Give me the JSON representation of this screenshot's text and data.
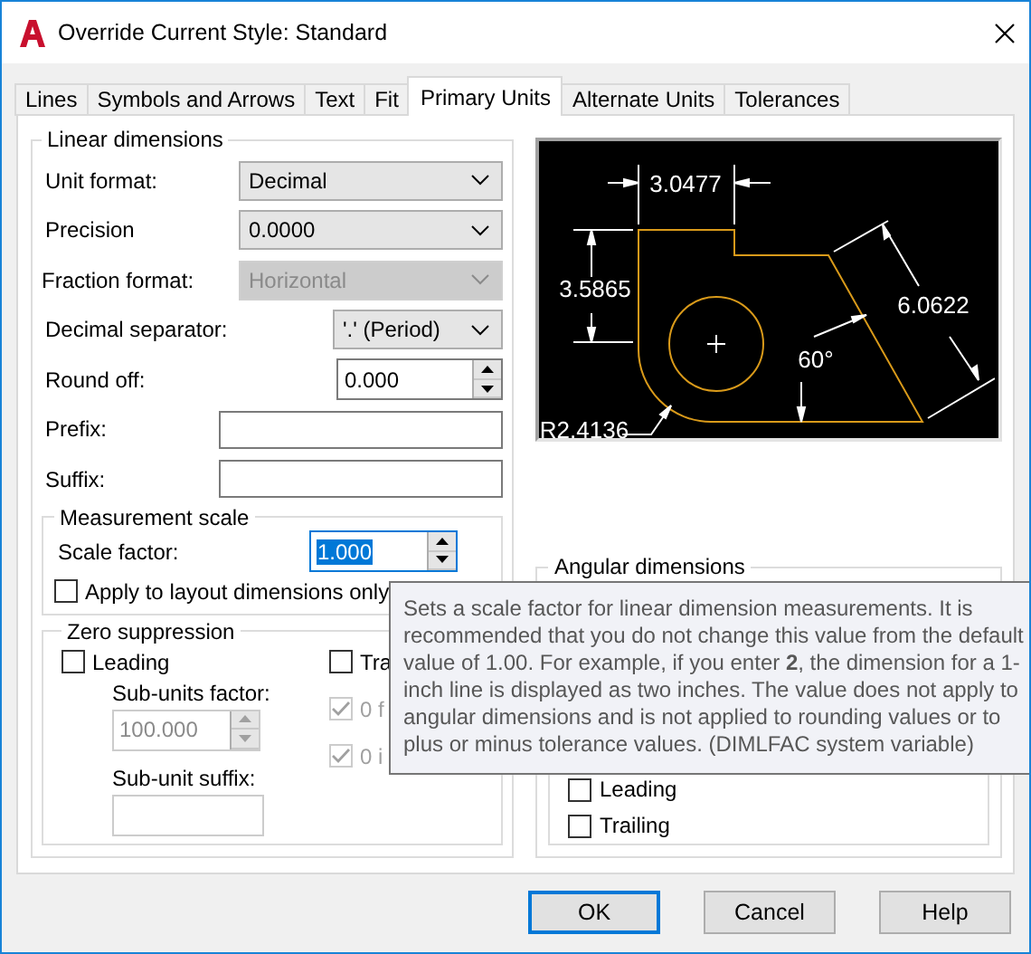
{
  "window": {
    "title": "Override Current Style: Standard"
  },
  "tabs": [
    {
      "label": "Lines",
      "selected": false
    },
    {
      "label": "Symbols and Arrows",
      "selected": false
    },
    {
      "label": "Text",
      "selected": false
    },
    {
      "label": "Fit",
      "selected": false
    },
    {
      "label": "Primary Units",
      "selected": true
    },
    {
      "label": "Alternate Units",
      "selected": false
    },
    {
      "label": "Tolerances",
      "selected": false
    }
  ],
  "linear": {
    "title": "Linear dimensions",
    "fields": [
      {
        "kind": "select",
        "label": "Unit format:",
        "value": "Decimal",
        "disabled": false
      },
      {
        "kind": "select",
        "label": "Precision",
        "value": "0.0000",
        "disabled": false
      },
      {
        "kind": "select",
        "label": "Fraction format:",
        "value": "Horizontal",
        "disabled": true
      },
      {
        "kind": "select",
        "label": "Decimal separator:",
        "value": "'.' (Period)",
        "disabled": false
      },
      {
        "kind": "spinner",
        "label": "Round off:",
        "value": "0.000",
        "disabled": false
      },
      {
        "kind": "text",
        "label": "Prefix:",
        "disabled": false
      },
      {
        "kind": "text",
        "label": "Suffix:",
        "disabled": false
      }
    ]
  },
  "measurement": {
    "title": "Measurement scale",
    "scale_label": "Scale factor:",
    "scale_value": "1.000",
    "selected": true,
    "apply": {
      "label": "Apply to layout dimensions only",
      "checked": false
    }
  },
  "zero": {
    "title": "Zero suppression",
    "leading": {
      "label": "Leading",
      "checked": false
    },
    "sub_units_factor": {
      "label": "Sub-units factor:",
      "value": "100.000",
      "disabled": true
    },
    "sub_unit_suffix": {
      "label": "Sub-unit suffix:"
    },
    "right": [
      {
        "label": "Tra",
        "checked": false,
        "disabled": false
      },
      {
        "label": "0 f",
        "checked": true,
        "disabled": true
      },
      {
        "label": "0 i",
        "checked": true,
        "disabled": true
      }
    ]
  },
  "preview": {
    "labels": [
      "3.0477",
      "3.5865",
      "6.0622",
      "60°",
      "R2.4136"
    ]
  },
  "angular": {
    "title": "Angular dimensions",
    "zero": [
      {
        "label": "Leading",
        "checked": false
      },
      {
        "label": "Trailing",
        "checked": false
      }
    ]
  },
  "tooltip": "Sets a scale factor for linear dimension measurements. It is\nrecommended that you do not change this value from the default\nvalue of 1.00. For example, if you enter **2**, the dimension for a 1-\ninch line is displayed as two inches. The value does not apply to\nangular dimensions and is not applied to rounding values or to\nplus or minus tolerance values. (DIMLFAC system variable)",
  "buttons": [
    {
      "label": "OK",
      "focused": true
    },
    {
      "label": "Cancel",
      "focused": false
    },
    {
      "label": "Help",
      "focused": false
    }
  ]
}
